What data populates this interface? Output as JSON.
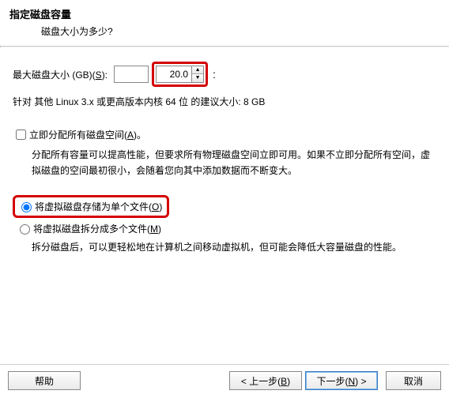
{
  "header": {
    "title": "指定磁盘容量",
    "subtitle": "磁盘大小为多少?"
  },
  "size": {
    "label_prefix": "最大磁盘大小 (GB)(",
    "label_mnemonic": "S",
    "label_suffix": "):",
    "value": "20.0",
    "colon": ":"
  },
  "recommend": "针对 其他 Linux 3.x 或更高版本内核 64 位 的建议大小: 8 GB",
  "allocate": {
    "label_prefix": "立即分配所有磁盘空间(",
    "label_mnemonic": "A",
    "label_suffix": ")。",
    "desc": "分配所有容量可以提高性能，但要求所有物理磁盘空间立即可用。如果不立即分配所有空间，虚拟磁盘的空间最初很小，会随着您向其中添加数据而不断变大。"
  },
  "storage": {
    "single_prefix": "将虚拟磁盘存储为单个文件(",
    "single_mnemonic": "O",
    "single_suffix": ")",
    "multi_prefix": "将虚拟磁盘拆分成多个文件(",
    "multi_mnemonic": "M",
    "multi_suffix": ")",
    "desc": "拆分磁盘后，可以更轻松地在计算机之间移动虚拟机，但可能会降低大容量磁盘的性能。"
  },
  "buttons": {
    "help": "帮助",
    "back_prefix": "< 上一步(",
    "back_mnemonic": "B",
    "back_suffix": ")",
    "next_prefix": "下一步(",
    "next_mnemonic": "N",
    "next_suffix": ") >",
    "cancel": "取消"
  }
}
